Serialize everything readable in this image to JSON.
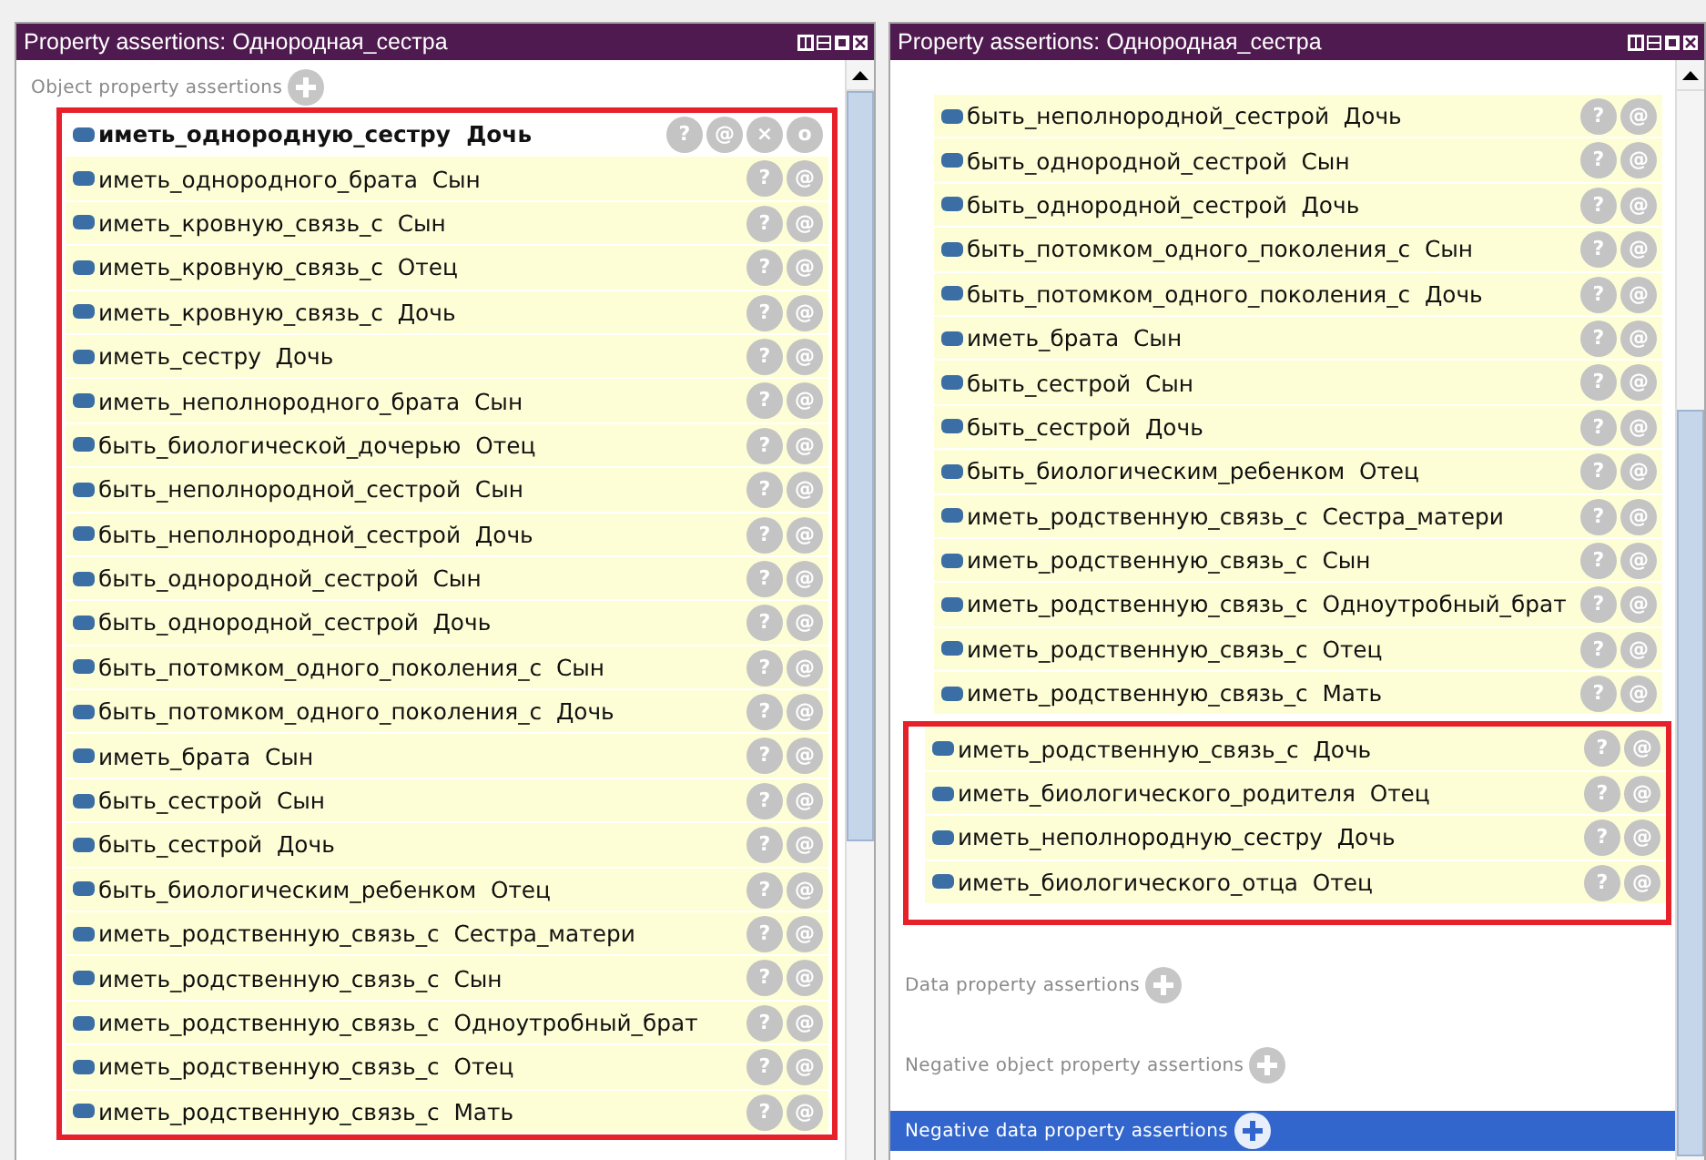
{
  "panels": [
    {
      "title": "Property assertions: Однородная_сестра",
      "sections": [
        {
          "label": "Object property assertions",
          "selected": false,
          "groups": [
            {
              "highlighted": true,
              "rows": [
                {
                  "property": "иметь_однородную_сестру",
                  "value": "Дочь",
                  "selected": true,
                  "actions": [
                    "?",
                    "@",
                    "×",
                    "o"
                  ]
                },
                {
                  "property": "иметь_однородного_брата",
                  "value": "Сын",
                  "selected": false,
                  "actions": [
                    "?",
                    "@"
                  ]
                },
                {
                  "property": "иметь_кровную_связь_с",
                  "value": "Сын",
                  "selected": false,
                  "actions": [
                    "?",
                    "@"
                  ]
                },
                {
                  "property": "иметь_кровную_связь_с",
                  "value": "Отец",
                  "selected": false,
                  "actions": [
                    "?",
                    "@"
                  ]
                },
                {
                  "property": "иметь_кровную_связь_с",
                  "value": "Дочь",
                  "selected": false,
                  "actions": [
                    "?",
                    "@"
                  ]
                },
                {
                  "property": "иметь_сестру",
                  "value": "Дочь",
                  "selected": false,
                  "actions": [
                    "?",
                    "@"
                  ]
                },
                {
                  "property": "иметь_неполнородного_брата",
                  "value": "Сын",
                  "selected": false,
                  "actions": [
                    "?",
                    "@"
                  ]
                },
                {
                  "property": "быть_биологической_дочерью",
                  "value": "Отец",
                  "selected": false,
                  "actions": [
                    "?",
                    "@"
                  ]
                },
                {
                  "property": "быть_неполнородной_сестрой",
                  "value": "Сын",
                  "selected": false,
                  "actions": [
                    "?",
                    "@"
                  ]
                },
                {
                  "property": "быть_неполнородной_сестрой",
                  "value": "Дочь",
                  "selected": false,
                  "actions": [
                    "?",
                    "@"
                  ]
                },
                {
                  "property": "быть_однородной_сестрой",
                  "value": "Сын",
                  "selected": false,
                  "actions": [
                    "?",
                    "@"
                  ]
                },
                {
                  "property": "быть_однородной_сестрой",
                  "value": "Дочь",
                  "selected": false,
                  "actions": [
                    "?",
                    "@"
                  ]
                },
                {
                  "property": "быть_потомком_одного_поколения_с",
                  "value": "Сын",
                  "selected": false,
                  "actions": [
                    "?",
                    "@"
                  ]
                },
                {
                  "property": "быть_потомком_одного_поколения_с",
                  "value": "Дочь",
                  "selected": false,
                  "actions": [
                    "?",
                    "@"
                  ]
                },
                {
                  "property": "иметь_брата",
                  "value": "Сын",
                  "selected": false,
                  "actions": [
                    "?",
                    "@"
                  ]
                },
                {
                  "property": "быть_сестрой",
                  "value": "Сын",
                  "selected": false,
                  "actions": [
                    "?",
                    "@"
                  ]
                },
                {
                  "property": "быть_сестрой",
                  "value": "Дочь",
                  "selected": false,
                  "actions": [
                    "?",
                    "@"
                  ]
                },
                {
                  "property": "быть_биологическим_ребенком",
                  "value": "Отец",
                  "selected": false,
                  "actions": [
                    "?",
                    "@"
                  ]
                },
                {
                  "property": "иметь_родственную_связь_с",
                  "value": "Сестра_матери",
                  "selected": false,
                  "actions": [
                    "?",
                    "@"
                  ]
                },
                {
                  "property": "иметь_родственную_связь_с",
                  "value": "Сын",
                  "selected": false,
                  "actions": [
                    "?",
                    "@"
                  ]
                },
                {
                  "property": "иметь_родственную_связь_с",
                  "value": "Одноутробный_брат",
                  "selected": false,
                  "actions": [
                    "?",
                    "@"
                  ]
                },
                {
                  "property": "иметь_родственную_связь_с",
                  "value": "Отец",
                  "selected": false,
                  "actions": [
                    "?",
                    "@"
                  ]
                },
                {
                  "property": "иметь_родственную_связь_с",
                  "value": "Мать",
                  "selected": false,
                  "actions": [
                    "?",
                    "@"
                  ]
                }
              ]
            }
          ]
        }
      ]
    },
    {
      "title": "Property assertions: Однородная_сестра",
      "sections": [
        {
          "groups": [
            {
              "highlighted": false,
              "rows": [
                {
                  "property": "быть_неполнородной_сестрой",
                  "value": "Дочь",
                  "selected": false,
                  "actions": [
                    "?",
                    "@"
                  ]
                },
                {
                  "property": "быть_однородной_сестрой",
                  "value": "Сын",
                  "selected": false,
                  "actions": [
                    "?",
                    "@"
                  ]
                },
                {
                  "property": "быть_однородной_сестрой",
                  "value": "Дочь",
                  "selected": false,
                  "actions": [
                    "?",
                    "@"
                  ]
                },
                {
                  "property": "быть_потомком_одного_поколения_с",
                  "value": "Сын",
                  "selected": false,
                  "actions": [
                    "?",
                    "@"
                  ]
                },
                {
                  "property": "быть_потомком_одного_поколения_с",
                  "value": "Дочь",
                  "selected": false,
                  "actions": [
                    "?",
                    "@"
                  ]
                },
                {
                  "property": "иметь_брата",
                  "value": "Сын",
                  "selected": false,
                  "actions": [
                    "?",
                    "@"
                  ]
                },
                {
                  "property": "быть_сестрой",
                  "value": "Сын",
                  "selected": false,
                  "actions": [
                    "?",
                    "@"
                  ]
                },
                {
                  "property": "быть_сестрой",
                  "value": "Дочь",
                  "selected": false,
                  "actions": [
                    "?",
                    "@"
                  ]
                },
                {
                  "property": "быть_биологическим_ребенком",
                  "value": "Отец",
                  "selected": false,
                  "actions": [
                    "?",
                    "@"
                  ]
                },
                {
                  "property": "иметь_родственную_связь_с",
                  "value": "Сестра_матери",
                  "selected": false,
                  "actions": [
                    "?",
                    "@"
                  ]
                },
                {
                  "property": "иметь_родственную_связь_с",
                  "value": "Сын",
                  "selected": false,
                  "actions": [
                    "?",
                    "@"
                  ]
                },
                {
                  "property": "иметь_родственную_связь_с",
                  "value": "Одноутробный_брат",
                  "selected": false,
                  "actions": [
                    "?",
                    "@"
                  ]
                },
                {
                  "property": "иметь_родственную_связь_с",
                  "value": "Отец",
                  "selected": false,
                  "actions": [
                    "?",
                    "@"
                  ]
                },
                {
                  "property": "иметь_родственную_связь_с",
                  "value": "Мать",
                  "selected": false,
                  "actions": [
                    "?",
                    "@"
                  ]
                }
              ]
            },
            {
              "highlighted": true,
              "rows": [
                {
                  "property": "иметь_родственную_связь_с",
                  "value": "Дочь",
                  "selected": false,
                  "actions": [
                    "?",
                    "@"
                  ]
                },
                {
                  "property": "иметь_биологического_родителя",
                  "value": "Отец",
                  "selected": false,
                  "actions": [
                    "?",
                    "@"
                  ]
                },
                {
                  "property": "иметь_неполнородную_сестру",
                  "value": "Дочь",
                  "selected": false,
                  "actions": [
                    "?",
                    "@"
                  ]
                },
                {
                  "property": "иметь_биологического_отца",
                  "value": "Отец",
                  "selected": false,
                  "actions": [
                    "?",
                    "@"
                  ]
                }
              ]
            }
          ]
        },
        {
          "label": "Data property assertions",
          "selected": false
        },
        {
          "label": "Negative object property assertions",
          "selected": false
        },
        {
          "label": "Negative data property assertions",
          "selected": true
        }
      ]
    }
  ]
}
